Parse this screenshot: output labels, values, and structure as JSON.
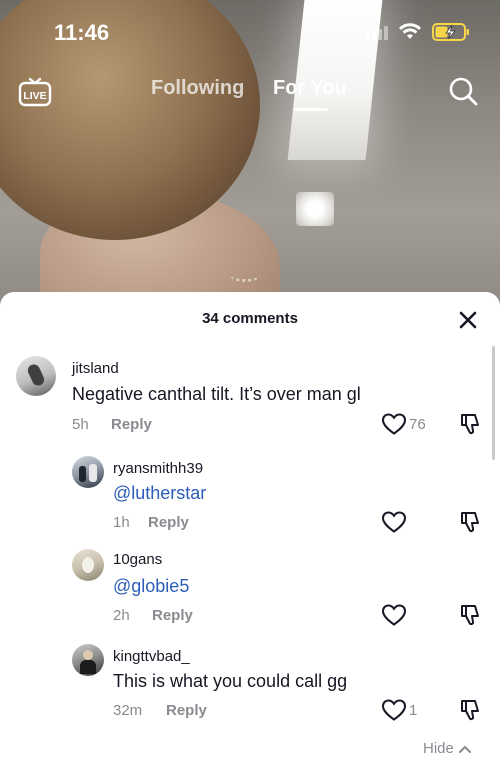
{
  "status_bar": {
    "time": "11:46"
  },
  "top_nav": {
    "live_label": "LIVE",
    "tabs": [
      {
        "label": "Following"
      },
      {
        "label": "For You"
      }
    ]
  },
  "comments_panel": {
    "count_label": "34 comments",
    "hide_label": "Hide",
    "comments": [
      {
        "username": "jitsland",
        "text": "Negative canthal tilt. It’s over man gl",
        "time": "5h",
        "reply_label": "Reply",
        "likes": "76"
      },
      {
        "username": "ryansmithh39",
        "text": "@lutherstar",
        "time": "1h",
        "reply_label": "Reply",
        "likes": ""
      },
      {
        "username": "10gans",
        "text": "@globie5",
        "time": "2h",
        "reply_label": "Reply",
        "likes": ""
      },
      {
        "username": "kingttvbad_",
        "text": "This is what you could call gg",
        "time": "32m",
        "reply_label": "Reply",
        "likes": "1"
      }
    ]
  },
  "colors": {
    "text_primary": "#161823",
    "text_secondary": "#8a8b91",
    "mention": "#2b5db9",
    "battery_charging": "#f7d549"
  }
}
